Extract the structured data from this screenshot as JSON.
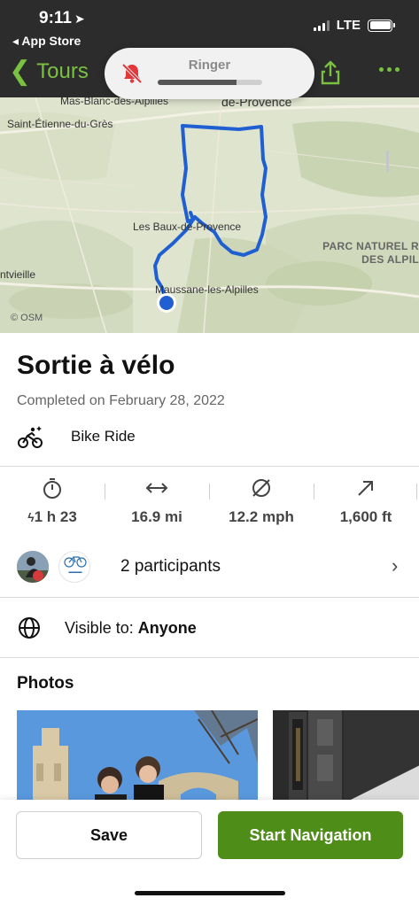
{
  "status_bar": {
    "time": "9:11",
    "back_app": "App Store",
    "network": "LTE"
  },
  "nav": {
    "back_label": "Tours",
    "accent_color": "#7ac142"
  },
  "ringer": {
    "title": "Ringer",
    "level": 0.75
  },
  "map": {
    "labels": {
      "mas_blanc": "Mas-Blanc-des-Alpilles",
      "de_provence": "de-Provence",
      "st_etienne": "Saint-Étienne-du-Grès",
      "les_baux": "Les Baux-de-Provence",
      "park_line1": "PARC NATUREL R",
      "park_line2": "DES ALPIL",
      "ntvieille": "ntvieille",
      "maussane": "Maussane-les-Alpilles"
    },
    "attribution": "© OSM",
    "route_color": "#1f5fd1"
  },
  "tour": {
    "title": "Sortie à vélo",
    "completed": "Completed on February 28, 2022",
    "activity": "Bike Ride"
  },
  "stats": [
    {
      "icon": "stopwatch-icon",
      "value": "1 h 23",
      "prefix_icon": "lightning-icon"
    },
    {
      "icon": "distance-arrows-icon",
      "value": "16.9 mi"
    },
    {
      "icon": "average-speed-icon",
      "value": "12.2 mph"
    },
    {
      "icon": "elevation-arrow-icon",
      "value": "1,600 ft"
    }
  ],
  "participants": {
    "label": "2 participants"
  },
  "visibility": {
    "prefix": "Visible to: ",
    "value": "Anyone"
  },
  "photos": {
    "title": "Photos"
  },
  "actions": {
    "save_label": "Save",
    "start_label": "Start Navigation",
    "start_color": "#4f8d19"
  }
}
